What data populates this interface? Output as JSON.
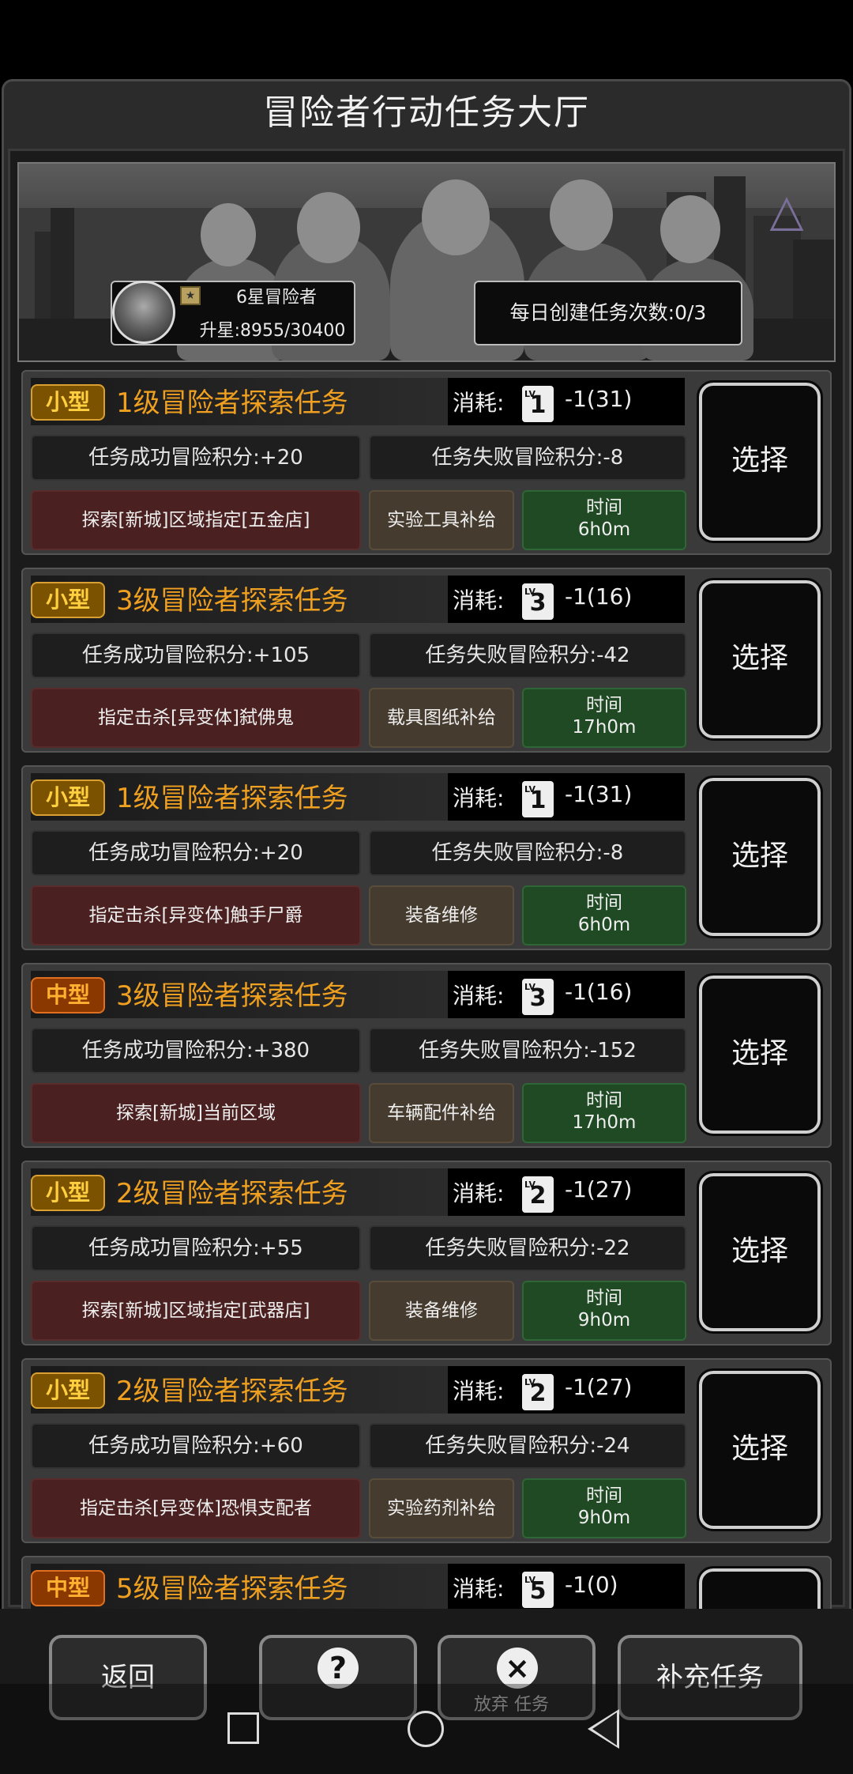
{
  "title": "冒险者行动任务大厅",
  "rank": {
    "name": "6星冒险者",
    "exp": "升星:8955/30400"
  },
  "daily": "每日创建任务次数:0/3",
  "labels": {
    "cost": "消耗:",
    "time": "时间",
    "select": "选择"
  },
  "tasks": [
    {
      "size": "小型",
      "name": "1级冒险者探索任务",
      "lv": "1",
      "cost": "-1(31)",
      "success": "任务成功冒险积分:+20",
      "fail": "任务失败冒险积分:-8",
      "objective": "探索[新城]区域指定[五金店]",
      "reward": "实验工具补给",
      "duration": "6h0m"
    },
    {
      "size": "小型",
      "name": "3级冒险者探索任务",
      "lv": "3",
      "cost": "-1(16)",
      "success": "任务成功冒险积分:+105",
      "fail": "任务失败冒险积分:-42",
      "objective": "指定击杀[异变体]弑佛鬼",
      "reward": "载具图纸补给",
      "duration": "17h0m"
    },
    {
      "size": "小型",
      "name": "1级冒险者探索任务",
      "lv": "1",
      "cost": "-1(31)",
      "success": "任务成功冒险积分:+20",
      "fail": "任务失败冒险积分:-8",
      "objective": "指定击杀[异变体]触手尸爵",
      "reward": "装备维修",
      "duration": "6h0m"
    },
    {
      "size": "中型",
      "name": "3级冒险者探索任务",
      "lv": "3",
      "cost": "-1(16)",
      "success": "任务成功冒险积分:+380",
      "fail": "任务失败冒险积分:-152",
      "objective": "探索[新城]当前区域",
      "reward": "车辆配件补给",
      "duration": "17h0m"
    },
    {
      "size": "小型",
      "name": "2级冒险者探索任务",
      "lv": "2",
      "cost": "-1(27)",
      "success": "任务成功冒险积分:+55",
      "fail": "任务失败冒险积分:-22",
      "objective": "探索[新城]区域指定[武器店]",
      "reward": "装备维修",
      "duration": "9h0m"
    },
    {
      "size": "小型",
      "name": "2级冒险者探索任务",
      "lv": "2",
      "cost": "-1(27)",
      "success": "任务成功冒险积分:+60",
      "fail": "任务失败冒险积分:-24",
      "objective": "指定击杀[异变体]恐惧支配者",
      "reward": "实验药剂补给",
      "duration": "9h0m"
    },
    {
      "size": "中型",
      "name": "5级冒险者探索任务",
      "lv": "5",
      "cost": "-1(0)",
      "success": "",
      "fail": "",
      "objective": "",
      "reward": "",
      "duration": ""
    }
  ],
  "bottom": {
    "back": "返回",
    "help_icon": "?",
    "abandon_icon": "×",
    "abandon": "放弃 任务",
    "refill": "补充任务"
  },
  "icons": {
    "help": "question-icon",
    "abandon": "close-circle-icon",
    "nav_square": "recent-apps-icon",
    "nav_circle": "home-icon",
    "nav_triangle": "back-icon"
  }
}
